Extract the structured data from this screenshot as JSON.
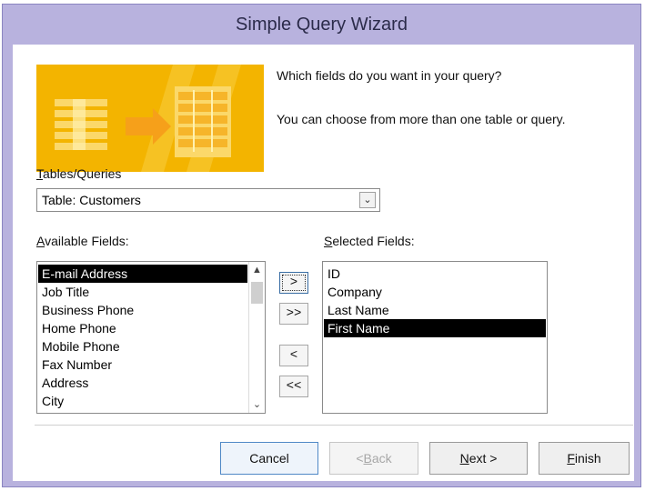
{
  "window": {
    "title": "Simple Query Wizard"
  },
  "prompt": {
    "line1": "Which fields do you want in your query?",
    "line2": "You can choose from more than one table or query."
  },
  "tables_label": {
    "mnemonic": "T",
    "rest": "ables/Queries"
  },
  "tables_combo": {
    "value": "Table: Customers",
    "dropdown_icon": "chevron-down-icon"
  },
  "available_label": {
    "mnemonic": "A",
    "rest": "vailable Fields:"
  },
  "selected_label": {
    "mnemonic": "S",
    "rest": "elected Fields:"
  },
  "available_fields": [
    "E-mail Address",
    "Job Title",
    "Business Phone",
    "Home Phone",
    "Mobile Phone",
    "Fax Number",
    "Address",
    "City"
  ],
  "available_selected_index": 0,
  "selected_fields": [
    "ID",
    "Company",
    "Last Name",
    "First Name"
  ],
  "selected_selected_index": 3,
  "move_buttons": {
    "add_one": ">",
    "add_all": ">>",
    "remove_one": "<",
    "remove_all": "<<"
  },
  "buttons": {
    "cancel": "Cancel",
    "back_prefix": "< ",
    "back_mnemonic": "B",
    "back_rest": "ack",
    "next_mnemonic": "N",
    "next_rest": "ext >",
    "finish_mnemonic": "F",
    "finish_rest": "inish"
  },
  "colors": {
    "banner": "#f3b400",
    "titlebar": "#b8b2de",
    "selection": "#000000"
  }
}
